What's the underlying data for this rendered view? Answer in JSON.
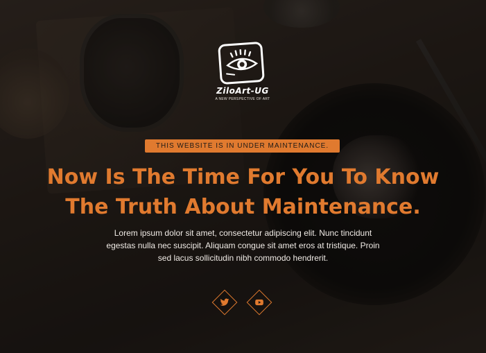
{
  "logo": {
    "name": "ZiloArt-UG",
    "tagline": "A NEW PERSPECTIVE OF ART"
  },
  "notice": {
    "badge": "THIS WEBSITE IS IN UNDER MAINTENANCE."
  },
  "hero": {
    "headline_line1": "Now Is The Time For You To Know",
    "headline_line2": "The Truth About Maintenance.",
    "description_line1": "Lorem ipsum dolor sit amet, consectetur adipiscing elit. Nunc tincidunt",
    "description_line2": "egestas nulla nec suscipit. Aliquam congue sit amet eros at tristique. Proin",
    "description_line3": "sed lacus sollicitudin nibh commodo hendrerit."
  },
  "social": {
    "items": [
      {
        "icon": "twitter-icon"
      },
      {
        "icon": "youtube-icon"
      }
    ]
  },
  "colors": {
    "accent": "#e07a2f",
    "text": "#f0ebe6",
    "badge_text": "#1e1a17"
  }
}
